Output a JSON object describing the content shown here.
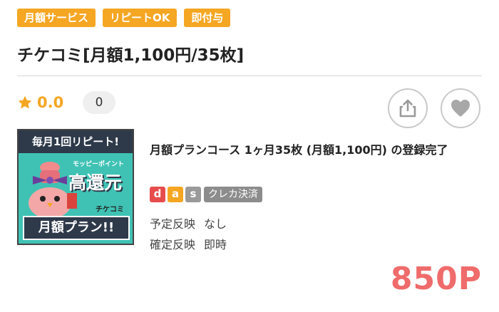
{
  "tags": [
    "月額サービス",
    "リピートOK",
    "即付与"
  ],
  "title": "チケコミ[月額1,100円/35枚]",
  "rating": {
    "value": "0.0",
    "icon": "star-icon",
    "count": "0"
  },
  "actions": {
    "share_icon": "share-icon",
    "favorite_icon": "heart-icon"
  },
  "banner": {
    "top_text": "毎月1回リピート!",
    "sub_text": "モッピーポイント",
    "main_text": "高還元",
    "logo_text": "チケコミ",
    "bottom_text": "月額プラン!!"
  },
  "offer": {
    "name": "月額プランコース 1ヶ月35枚 (月額1,100円) の登録完了",
    "payment_letters": [
      "d",
      "a",
      "s"
    ],
    "payment_method": "クレカ決済",
    "rows": [
      {
        "label": "予定反映",
        "value": "なし"
      },
      {
        "label": "確定反映",
        "value": "即時"
      }
    ],
    "points": "850P"
  },
  "colors": {
    "accent": "#f5a623",
    "points": "#f06b6b",
    "teal": "#3fc2b4"
  }
}
